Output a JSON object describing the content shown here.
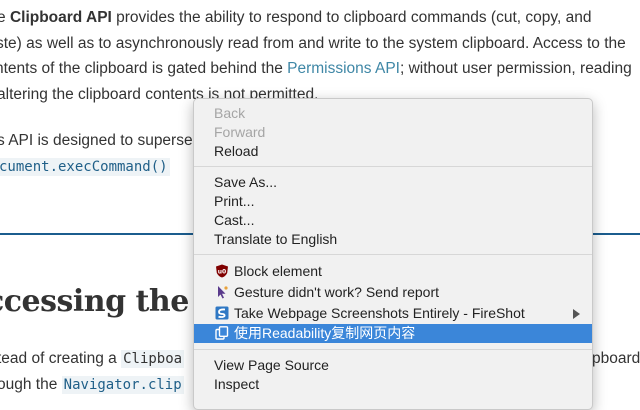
{
  "document": {
    "line1": {
      "pre": "e ",
      "bold": "Clipboard API",
      "post": " provides the ability to respond to clipboard commands (cut, copy, and"
    },
    "line2": "ste) as well as to asynchronously read from and write to the system clipboard. Access to the",
    "line3": {
      "pre": "ntents of the clipboard is gated behind the ",
      "link": "Permissions API",
      "post": "; without user permission, reading"
    },
    "line4": "altering the clipboard contents is not permitted.",
    "line5": "s API is designed to superse",
    "line6_code": "cument.execCommand()",
    "heading": "ccessing the",
    "line7": {
      "pre": "tead of creating a ",
      "code": "Clipboa",
      "right": "pboard"
    },
    "line8": {
      "pre": "ough the ",
      "code": "Navigator.clip"
    }
  },
  "context_menu": {
    "group1": [
      {
        "label": "Back",
        "disabled": true
      },
      {
        "label": "Forward",
        "disabled": true
      },
      {
        "label": "Reload",
        "disabled": false
      }
    ],
    "group2": [
      {
        "label": "Save As..."
      },
      {
        "label": "Print..."
      },
      {
        "label": "Cast..."
      },
      {
        "label": "Translate to English"
      }
    ],
    "group3": [
      {
        "label": "Block element",
        "icon": "ublock-origin-icon"
      },
      {
        "label": "Gesture didn't work? Send report",
        "icon": "gesture-cursor-icon"
      },
      {
        "label": "Take Webpage Screenshots Entirely - FireShot",
        "icon": "fireshot-icon",
        "has_submenu": true
      },
      {
        "label": "使用Readability复制网页内容",
        "icon": "copy-readability-icon",
        "highlighted": true
      }
    ],
    "group4": [
      {
        "label": "View Page Source"
      },
      {
        "label": "Inspect"
      }
    ]
  },
  "colors": {
    "link": "#3f87a6",
    "highlight": "#3b86d9",
    "rule": "#1b5d8e"
  }
}
